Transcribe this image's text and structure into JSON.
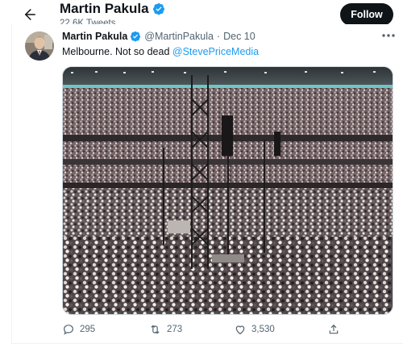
{
  "header": {
    "title": "Martin Pakula",
    "tweet_count": "22.6K Tweets",
    "follow_label": "Follow"
  },
  "tweet": {
    "author_name": "Martin Pakula",
    "handle": "@MartinPakula",
    "separator": "·",
    "date": "Dec 10",
    "text": "Melbourne. Not so dead",
    "mention": "@StevePriceMedia",
    "actions": {
      "replies": "295",
      "retweets": "273",
      "likes": "3,530"
    }
  },
  "icons": {
    "back": "arrow-left-icon",
    "verified": "verified-badge-icon",
    "more": "more-horizontal-icon",
    "reply": "reply-icon",
    "retweet": "retweet-icon",
    "like": "heart-icon",
    "share": "share-icon"
  },
  "colors": {
    "accent": "#1d9bf0",
    "text_primary": "#0f1419",
    "text_secondary": "#536471",
    "follow_button": "#0f1419"
  }
}
